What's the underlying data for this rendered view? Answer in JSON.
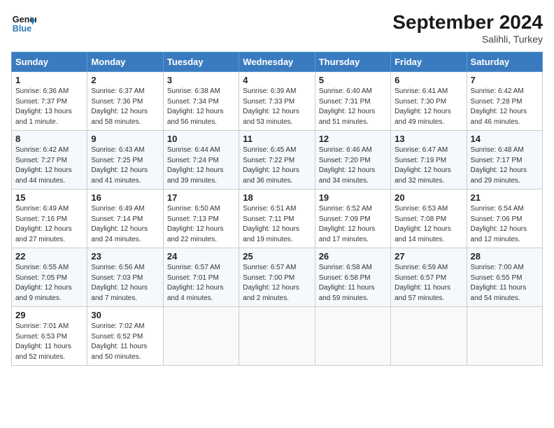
{
  "header": {
    "logo_line1": "General",
    "logo_line2": "Blue",
    "month_title": "September 2024",
    "location": "Salihli, Turkey"
  },
  "days_of_week": [
    "Sunday",
    "Monday",
    "Tuesday",
    "Wednesday",
    "Thursday",
    "Friday",
    "Saturday"
  ],
  "weeks": [
    [
      {
        "day": "1",
        "sunrise": "6:36 AM",
        "sunset": "7:37 PM",
        "daylight": "13 hours and 1 minute."
      },
      {
        "day": "2",
        "sunrise": "6:37 AM",
        "sunset": "7:36 PM",
        "daylight": "12 hours and 58 minutes."
      },
      {
        "day": "3",
        "sunrise": "6:38 AM",
        "sunset": "7:34 PM",
        "daylight": "12 hours and 56 minutes."
      },
      {
        "day": "4",
        "sunrise": "6:39 AM",
        "sunset": "7:33 PM",
        "daylight": "12 hours and 53 minutes."
      },
      {
        "day": "5",
        "sunrise": "6:40 AM",
        "sunset": "7:31 PM",
        "daylight": "12 hours and 51 minutes."
      },
      {
        "day": "6",
        "sunrise": "6:41 AM",
        "sunset": "7:30 PM",
        "daylight": "12 hours and 49 minutes."
      },
      {
        "day": "7",
        "sunrise": "6:42 AM",
        "sunset": "7:28 PM",
        "daylight": "12 hours and 46 minutes."
      }
    ],
    [
      {
        "day": "8",
        "sunrise": "6:42 AM",
        "sunset": "7:27 PM",
        "daylight": "12 hours and 44 minutes."
      },
      {
        "day": "9",
        "sunrise": "6:43 AM",
        "sunset": "7:25 PM",
        "daylight": "12 hours and 41 minutes."
      },
      {
        "day": "10",
        "sunrise": "6:44 AM",
        "sunset": "7:24 PM",
        "daylight": "12 hours and 39 minutes."
      },
      {
        "day": "11",
        "sunrise": "6:45 AM",
        "sunset": "7:22 PM",
        "daylight": "12 hours and 36 minutes."
      },
      {
        "day": "12",
        "sunrise": "6:46 AM",
        "sunset": "7:20 PM",
        "daylight": "12 hours and 34 minutes."
      },
      {
        "day": "13",
        "sunrise": "6:47 AM",
        "sunset": "7:19 PM",
        "daylight": "12 hours and 32 minutes."
      },
      {
        "day": "14",
        "sunrise": "6:48 AM",
        "sunset": "7:17 PM",
        "daylight": "12 hours and 29 minutes."
      }
    ],
    [
      {
        "day": "15",
        "sunrise": "6:49 AM",
        "sunset": "7:16 PM",
        "daylight": "12 hours and 27 minutes."
      },
      {
        "day": "16",
        "sunrise": "6:49 AM",
        "sunset": "7:14 PM",
        "daylight": "12 hours and 24 minutes."
      },
      {
        "day": "17",
        "sunrise": "6:50 AM",
        "sunset": "7:13 PM",
        "daylight": "12 hours and 22 minutes."
      },
      {
        "day": "18",
        "sunrise": "6:51 AM",
        "sunset": "7:11 PM",
        "daylight": "12 hours and 19 minutes."
      },
      {
        "day": "19",
        "sunrise": "6:52 AM",
        "sunset": "7:09 PM",
        "daylight": "12 hours and 17 minutes."
      },
      {
        "day": "20",
        "sunrise": "6:53 AM",
        "sunset": "7:08 PM",
        "daylight": "12 hours and 14 minutes."
      },
      {
        "day": "21",
        "sunrise": "6:54 AM",
        "sunset": "7:06 PM",
        "daylight": "12 hours and 12 minutes."
      }
    ],
    [
      {
        "day": "22",
        "sunrise": "6:55 AM",
        "sunset": "7:05 PM",
        "daylight": "12 hours and 9 minutes."
      },
      {
        "day": "23",
        "sunrise": "6:56 AM",
        "sunset": "7:03 PM",
        "daylight": "12 hours and 7 minutes."
      },
      {
        "day": "24",
        "sunrise": "6:57 AM",
        "sunset": "7:01 PM",
        "daylight": "12 hours and 4 minutes."
      },
      {
        "day": "25",
        "sunrise": "6:57 AM",
        "sunset": "7:00 PM",
        "daylight": "12 hours and 2 minutes."
      },
      {
        "day": "26",
        "sunrise": "6:58 AM",
        "sunset": "6:58 PM",
        "daylight": "11 hours and 59 minutes."
      },
      {
        "day": "27",
        "sunrise": "6:59 AM",
        "sunset": "6:57 PM",
        "daylight": "11 hours and 57 minutes."
      },
      {
        "day": "28",
        "sunrise": "7:00 AM",
        "sunset": "6:55 PM",
        "daylight": "11 hours and 54 minutes."
      }
    ],
    [
      {
        "day": "29",
        "sunrise": "7:01 AM",
        "sunset": "6:53 PM",
        "daylight": "11 hours and 52 minutes."
      },
      {
        "day": "30",
        "sunrise": "7:02 AM",
        "sunset": "6:52 PM",
        "daylight": "11 hours and 50 minutes."
      },
      null,
      null,
      null,
      null,
      null
    ]
  ],
  "labels": {
    "sunrise": "Sunrise:",
    "sunset": "Sunset:",
    "daylight": "Daylight:"
  }
}
